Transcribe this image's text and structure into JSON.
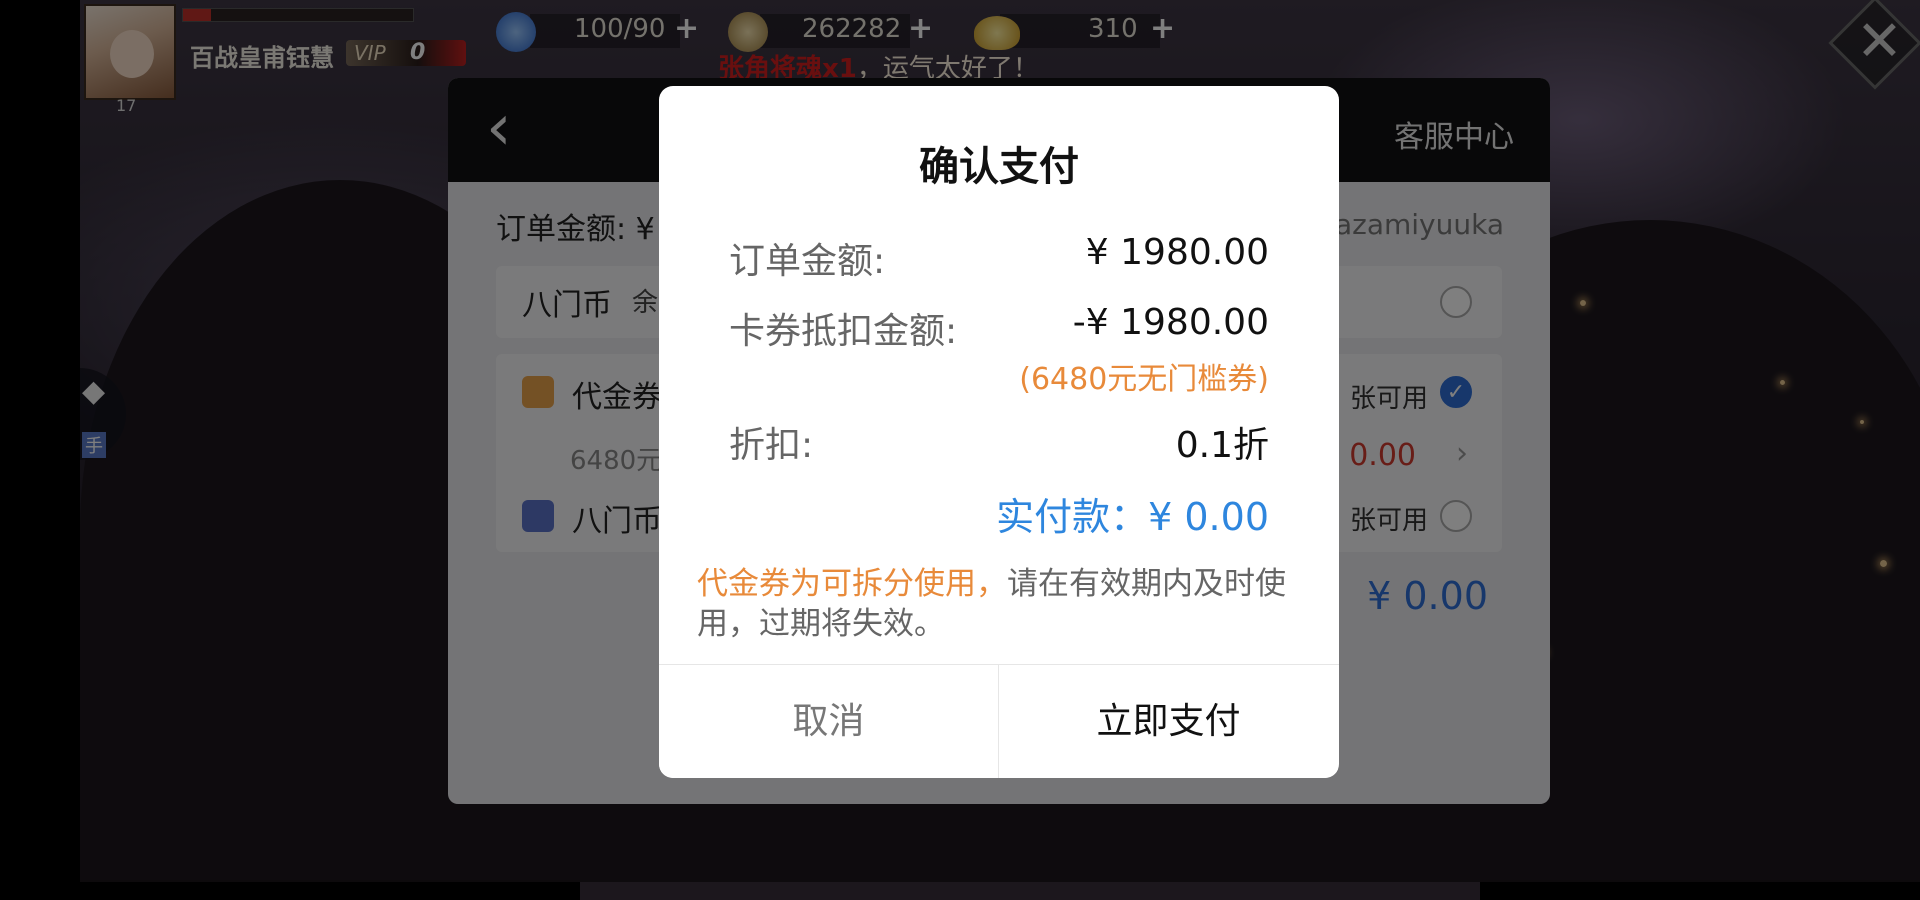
{
  "hud": {
    "player_name": "百战皇甫钰慧",
    "level": "17",
    "vip_label": "VIP",
    "vip_level": "0",
    "stamina": "100/90",
    "copper": "262282",
    "gold": "310"
  },
  "broadcast": {
    "highlight": "张角将魂x1",
    "tail": "，运气太好了！"
  },
  "side_tab": {
    "label": "手"
  },
  "panel": {
    "service_center": "客服中心",
    "order_amount_label": "订单金额: ¥",
    "account_name": "kazamiyuuka",
    "bamen_coin": "八门币",
    "bamen_coin_balance": "余",
    "voucher": "代金券",
    "voucher_available": "张可用",
    "voucher_sub": "6480元",
    "voucher_discount": "0.00",
    "bamen_coin_card": "八门币",
    "card_available": "张可用",
    "total": "¥ 0.00"
  },
  "modal": {
    "title": "确认支付",
    "order_amount_label": "订单金额:",
    "order_amount_value": "¥ 1980.00",
    "coupon_deduct_label": "卡券抵扣金额:",
    "coupon_deduct_value": "-¥ 1980.00",
    "coupon_note": "(6480元无门槛券)",
    "discount_label": "折扣:",
    "discount_value": "0.1折",
    "actual_payment": "实付款：¥ 0.00",
    "tip_highlight": "代金券为可拆分使用，",
    "tip_rest": "请在有效期内及时使用，过期将失效。",
    "cancel_button": "取消",
    "pay_button": "立即支付"
  },
  "colors": {
    "accent_blue": "#2e86de",
    "accent_orange": "#e88a3a",
    "warning_red": "#d21e1e"
  }
}
